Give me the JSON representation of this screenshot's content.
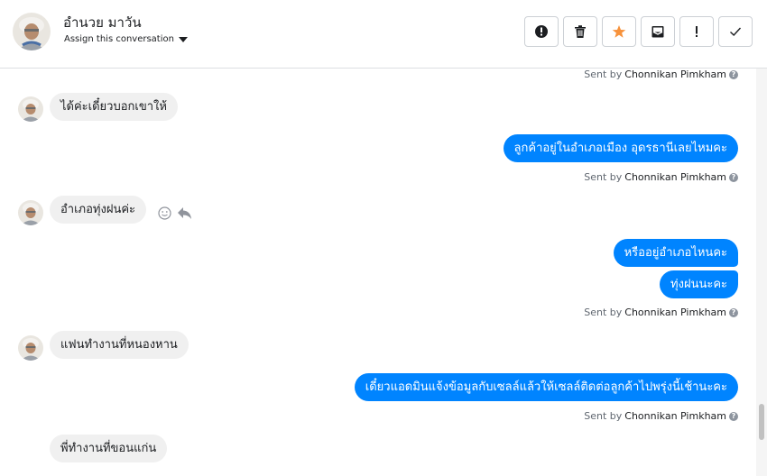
{
  "contact": {
    "name": "อำนวย มาวัน",
    "assign_label": "Assign this conversation"
  },
  "toolbar": {
    "buttons": [
      {
        "name": "report-button",
        "icon": "alert-circle-icon"
      },
      {
        "name": "delete-button",
        "icon": "trash-icon"
      },
      {
        "name": "star-button",
        "icon": "star-icon",
        "color": "#f7923b"
      },
      {
        "name": "archive-button",
        "icon": "inbox-icon"
      },
      {
        "name": "mark-important-button",
        "icon": "exclamation-icon"
      },
      {
        "name": "done-button",
        "icon": "check-icon"
      }
    ]
  },
  "colors": {
    "outgoing_bubble": "#0084ff",
    "incoming_bubble": "#f0f0f0",
    "star": "#f7923b"
  },
  "sent_by_prefix": "Sent by",
  "agent_name": "Chonnikan Pimkham",
  "messages": [
    {
      "dir": "in",
      "text": "ได้ค่ะเดี๋ยวบอกเขาให้"
    },
    {
      "dir": "out",
      "text": "ลูกค้าอยู่ในอำเภอเมือง อุดรธานีเลยไหมคะ"
    },
    {
      "dir": "in",
      "text": "อำเภอทุ่งฝนค่ะ"
    },
    {
      "dir": "out",
      "text": "หรืออยู่อำเภอไหนคะ"
    },
    {
      "dir": "out",
      "text": "ทุ่งฝนนะคะ"
    },
    {
      "dir": "in",
      "text": "แฟนทำงานที่หนองหาน"
    },
    {
      "dir": "out",
      "text": "เดี๋ยวแอดมินแจ้งข้อมูลกับเซลล์แล้วให้เซลล์ติดต่อลูกค้าไปพรุ่งนี้เช้านะคะ"
    },
    {
      "dir": "in",
      "text": "พี่ทำงานที่ขอนแก่น"
    }
  ]
}
